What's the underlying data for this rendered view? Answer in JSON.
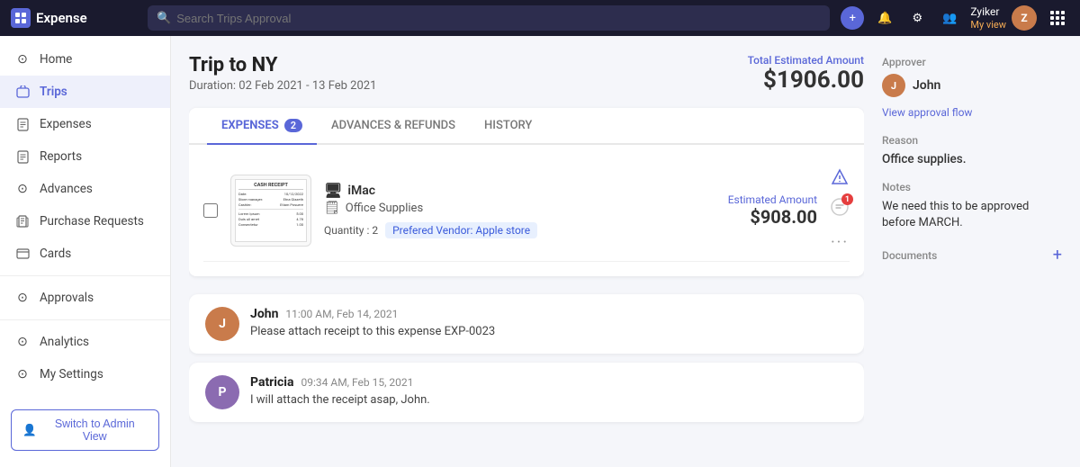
{
  "app": {
    "logo_text": "Expense",
    "logo_icon": "E"
  },
  "topbar": {
    "search_placeholder": "Search Trips Approval",
    "user_name": "Zyiker",
    "user_view": "My view",
    "add_icon": "+",
    "bell_icon": "🔔",
    "settings_icon": "⚙",
    "people_icon": "👥",
    "grid_label": "apps"
  },
  "sidebar": {
    "items": [
      {
        "id": "home",
        "label": "Home",
        "icon": "⊙",
        "active": false
      },
      {
        "id": "trips",
        "label": "Trips",
        "icon": "📁",
        "active": true
      },
      {
        "id": "expenses",
        "label": "Expenses",
        "icon": "🗒",
        "active": false
      },
      {
        "id": "reports",
        "label": "Reports",
        "icon": "📋",
        "active": false
      },
      {
        "id": "advances",
        "label": "Advances",
        "icon": "⊙",
        "active": false
      },
      {
        "id": "purchase-requests",
        "label": "Purchase Requests",
        "icon": "🔒",
        "active": false
      },
      {
        "id": "cards",
        "label": "Cards",
        "icon": "💳",
        "active": false
      },
      {
        "id": "approvals",
        "label": "Approvals",
        "icon": "⊙",
        "active": false
      },
      {
        "id": "analytics",
        "label": "Analytics",
        "icon": "⊙",
        "active": false
      },
      {
        "id": "my-settings",
        "label": "My Settings",
        "icon": "⊙",
        "active": false
      }
    ],
    "switch_admin_label": "Switch to Admin View",
    "switch_admin_icon": "👤"
  },
  "trip": {
    "title": "Trip to NY",
    "duration": "Duration: 02 Feb 2021 - 13 Feb 2021",
    "total_label": "Total Estimated Amount",
    "total_amount": "$1906.00"
  },
  "tabs": [
    {
      "id": "expenses",
      "label": "EXPENSES",
      "badge": "2",
      "active": true
    },
    {
      "id": "advances-refunds",
      "label": "ADVANCES & REFUNDS",
      "badge": "",
      "active": false
    },
    {
      "id": "history",
      "label": "HISTORY",
      "badge": "",
      "active": false
    }
  ],
  "expense": {
    "name": "iMac",
    "category": "Office Supplies",
    "quantity_label": "Quantity : 2",
    "vendor_label": "Prefered Vendor:",
    "vendor_name": "Apple store",
    "estimated_label": "Estimated Amount",
    "estimated_value": "$908.00",
    "receipt": {
      "title": "CASH RECEIPT",
      "line1_key": "Date:",
      "line1_val": "10/12/2022",
      "line2_key": "Store manager:",
      "line2_val": "Etna Glazeth",
      "line3_key": "Cashier:",
      "line3_val": "Etiam Posuere",
      "line4_key": "Lorem Ipsum",
      "line4_val": "5.00",
      "line5_key": "Duis ull amet",
      "line5_val": "4.78",
      "line6_key": "Consectetur",
      "line6_val": "1.00"
    }
  },
  "comments": [
    {
      "id": "john",
      "name": "John",
      "time": "11:00 AM, Feb 14, 2021",
      "text": "Please attach receipt to this expense EXP-0023",
      "avatar_letter": "J",
      "avatar_color": "#c97b4b"
    },
    {
      "id": "patricia",
      "name": "Patricia",
      "time": "09:34 AM, Feb 15, 2021",
      "text": "I will attach the receipt asap, John.",
      "avatar_letter": "P",
      "avatar_color": "#8b6bb1"
    }
  ],
  "right_panel": {
    "approver_label": "Approver",
    "approver_name": "John",
    "approval_flow_link": "View approval flow",
    "reason_label": "Reason",
    "reason_value": "Office supplies.",
    "notes_label": "Notes",
    "notes_value": "We need this to be approved before MARCH.",
    "documents_label": "Documents"
  }
}
